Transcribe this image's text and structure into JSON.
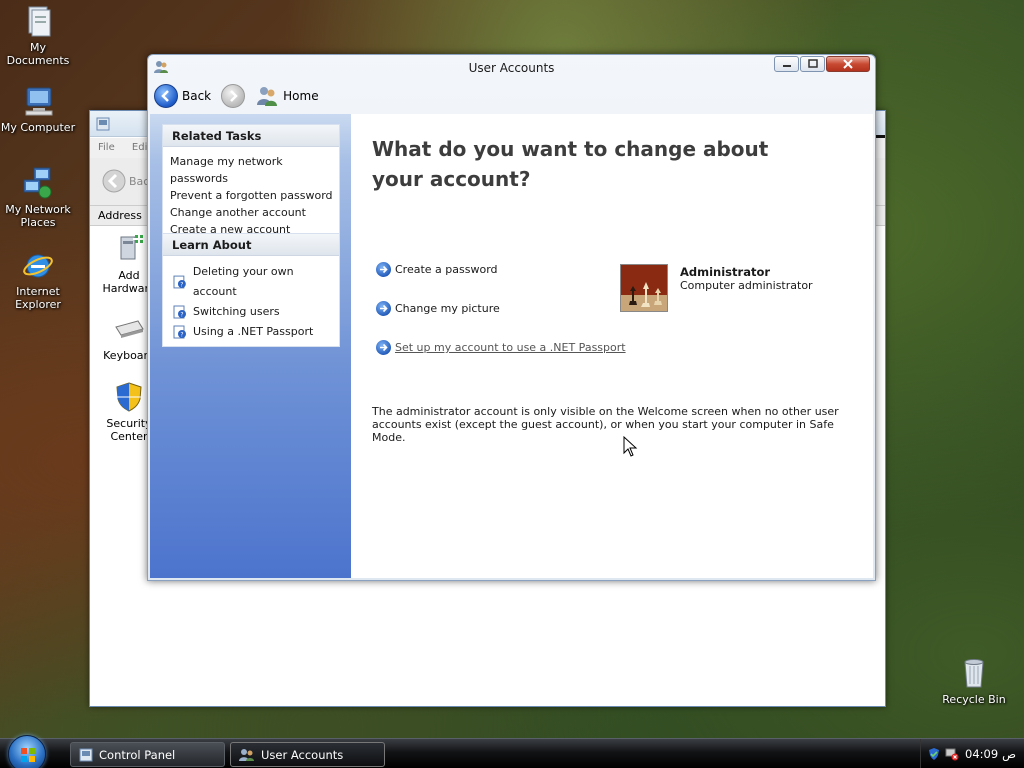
{
  "desktop": {
    "icons": [
      {
        "label": "My Documents"
      },
      {
        "label": "My Computer"
      },
      {
        "label": "My Network Places"
      },
      {
        "label": "Internet Explorer"
      }
    ],
    "recycle_bin": "Recycle Bin"
  },
  "control_panel_window": {
    "menu": [
      "File",
      "Edit"
    ],
    "back_label": "Back",
    "address_label": "Address",
    "items": [
      "Add Hardware",
      "Keyboard",
      "Security Center"
    ]
  },
  "user_accounts_window": {
    "title": "User Accounts",
    "toolbar": {
      "back": "Back",
      "home": "Home"
    },
    "related_tasks": {
      "heading": "Related Tasks",
      "links": [
        "Manage my network passwords",
        "Prevent a forgotten password",
        "Change another account",
        "Create a new account"
      ]
    },
    "learn_about": {
      "heading": "Learn About",
      "links": [
        "Deleting your own account",
        "Switching users",
        "Using a .NET Passport"
      ]
    },
    "main": {
      "heading": "What do you want to change about your account?",
      "actions": [
        "Create a password",
        "Change my picture",
        "Set up my account to use a .NET Passport"
      ],
      "account": {
        "name": "Administrator",
        "role": "Computer administrator"
      },
      "info": "The administrator account is only visible on the Welcome screen when no other user accounts exist (except the guest account), or when you start your computer in Safe Mode."
    }
  },
  "taskbar": {
    "buttons": [
      "Control Panel",
      "User Accounts"
    ],
    "clock": "04:09",
    "clock_suffix": "ص"
  },
  "colors": {
    "sidebar_top": "#c9d9f0",
    "sidebar_bottom": "#4c74cd",
    "heading": "#3d3d3d",
    "arrow_blue": "#1f58b8"
  }
}
